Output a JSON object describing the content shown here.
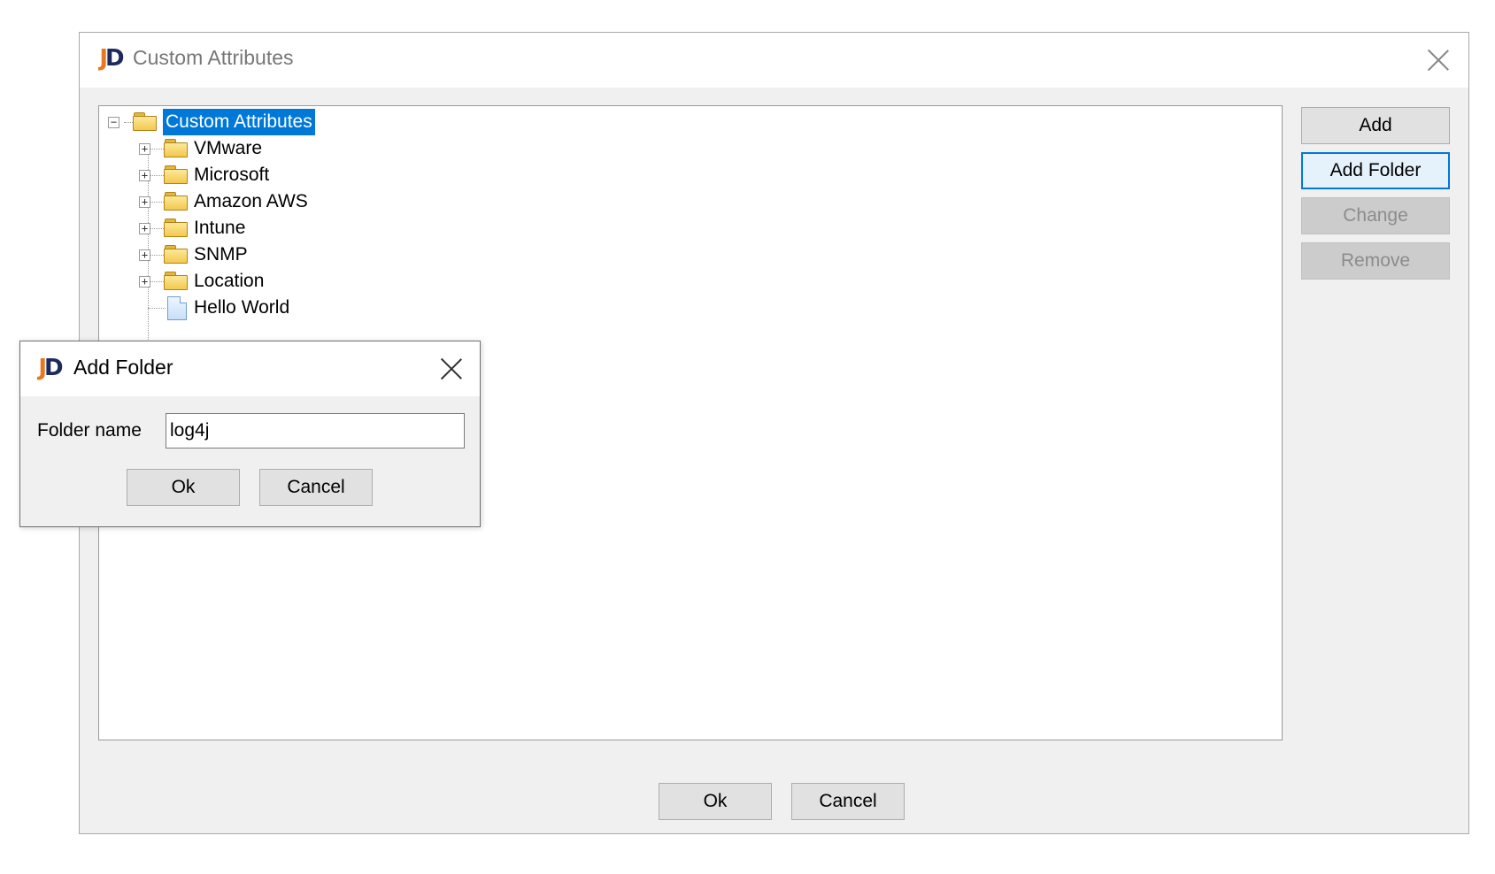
{
  "main_window": {
    "title": "Custom Attributes",
    "logo_text_j": "J",
    "logo_text_d": "D"
  },
  "tree": {
    "root": {
      "label": "Custom Attributes",
      "expander": "−",
      "icon": "folder-icon",
      "selected": true
    },
    "children": [
      {
        "label": "VMware",
        "expander": "+",
        "icon": "folder-icon"
      },
      {
        "label": "Microsoft",
        "expander": "+",
        "icon": "folder-icon"
      },
      {
        "label": "Amazon AWS",
        "expander": "+",
        "icon": "folder-icon"
      },
      {
        "label": "Intune",
        "expander": "+",
        "icon": "folder-icon"
      },
      {
        "label": "SNMP",
        "expander": "+",
        "icon": "folder-icon"
      },
      {
        "label": "Location",
        "expander": "+",
        "icon": "folder-icon"
      },
      {
        "label": "Hello World",
        "icon": "document-icon"
      }
    ]
  },
  "side_buttons": {
    "add": "Add",
    "add_folder": "Add Folder",
    "change": "Change",
    "remove": "Remove"
  },
  "footer_buttons": {
    "ok": "Ok",
    "cancel": "Cancel"
  },
  "dialog": {
    "title": "Add Folder",
    "field_label": "Folder name",
    "folder_name_value": "log4j",
    "ok": "Ok",
    "cancel": "Cancel"
  },
  "colors": {
    "selection": "#0078d7",
    "logo_orange": "#e87722",
    "logo_navy": "#1c2a5c",
    "window_bg": "#f0f0f0"
  }
}
